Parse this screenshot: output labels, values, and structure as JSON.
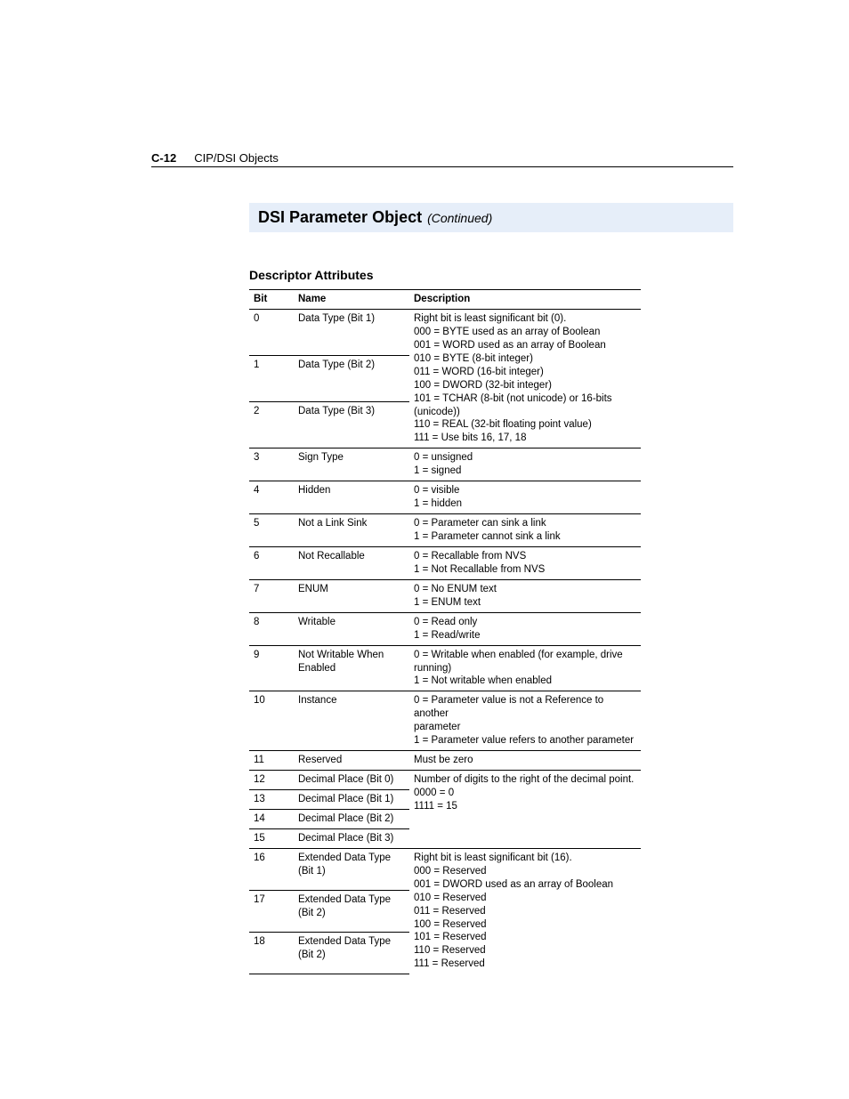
{
  "header": {
    "page_number": "C-12",
    "breadcrumb": "CIP/DSI Objects"
  },
  "title": {
    "main": "DSI Parameter Object",
    "continued": "(Continued)"
  },
  "section_heading": "Descriptor Attributes",
  "table": {
    "headers": {
      "bit": "Bit",
      "name": "Name",
      "description": "Description"
    },
    "groups": [
      {
        "rows": [
          {
            "bit": "0",
            "name": "Data Type (Bit 1)"
          },
          {
            "bit": "1",
            "name": "Data Type (Bit 2)"
          },
          {
            "bit": "2",
            "name": "Data Type (Bit 3)"
          }
        ],
        "description": "Right bit is least significant bit (0).\n000 = BYTE used as an array of Boolean\n001 = WORD used as an array of Boolean\n010 = BYTE (8-bit integer)\n011 = WORD (16-bit integer)\n100 = DWORD (32-bit integer)\n101 = TCHAR (8-bit (not unicode) or 16-bits (unicode))\n110 = REAL (32-bit floating point value)\n111 = Use bits 16, 17, 18"
      },
      {
        "rows": [
          {
            "bit": "3",
            "name": "Sign Type"
          }
        ],
        "description": "0 = unsigned\n1 = signed"
      },
      {
        "rows": [
          {
            "bit": "4",
            "name": "Hidden"
          }
        ],
        "description": "0 = visible\n1 = hidden"
      },
      {
        "rows": [
          {
            "bit": "5",
            "name": "Not a Link Sink"
          }
        ],
        "description": "0 = Parameter can sink a link\n1 = Parameter cannot sink a link"
      },
      {
        "rows": [
          {
            "bit": "6",
            "name": "Not Recallable"
          }
        ],
        "description": "0 = Recallable from NVS\n1 = Not Recallable from NVS"
      },
      {
        "rows": [
          {
            "bit": "7",
            "name": "ENUM"
          }
        ],
        "description": "0 = No ENUM text\n1 = ENUM text"
      },
      {
        "rows": [
          {
            "bit": "8",
            "name": "Writable"
          }
        ],
        "description": "0 = Read only\n1 = Read/write"
      },
      {
        "rows": [
          {
            "bit": "9",
            "name": "Not Writable When Enabled"
          }
        ],
        "description": "0 = Writable when enabled (for example, drive running)\n1 = Not writable when enabled"
      },
      {
        "rows": [
          {
            "bit": "10",
            "name": "Instance"
          }
        ],
        "description": "0 = Parameter value is not a Reference to another\n        parameter\n1 = Parameter value refers to another parameter"
      },
      {
        "rows": [
          {
            "bit": "11",
            "name": "Reserved"
          }
        ],
        "description": "Must be zero"
      },
      {
        "rows": [
          {
            "bit": "12",
            "name": "Decimal Place (Bit 0)"
          },
          {
            "bit": "13",
            "name": "Decimal Place (Bit 1)"
          },
          {
            "bit": "14",
            "name": "Decimal Place (Bit 2)"
          },
          {
            "bit": "15",
            "name": "Decimal Place (Bit 3)"
          }
        ],
        "description": "Number of digits to the right of the decimal point.\n0000 = 0\n1111 = 15"
      },
      {
        "rows": [
          {
            "bit": "16",
            "name": "Extended Data Type (Bit 1)"
          },
          {
            "bit": "17",
            "name": "Extended Data Type (Bit 2)"
          },
          {
            "bit": "18",
            "name": "Extended Data Type (Bit 2)"
          }
        ],
        "description": "Right bit is least significant bit (16).\n000 = Reserved\n001 = DWORD used as an array of Boolean\n010 = Reserved\n011 = Reserved\n100 = Reserved\n101 = Reserved\n110 = Reserved\n111 = Reserved"
      }
    ]
  }
}
